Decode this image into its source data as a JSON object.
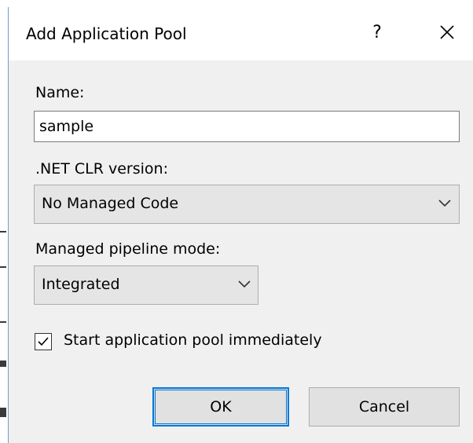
{
  "dialog": {
    "title": "Add Application Pool",
    "help_glyph": "?",
    "name_label": "Name:",
    "name_value": "sample",
    "clr_label": ".NET CLR version:",
    "clr_value": "No Managed Code",
    "pipeline_label": "Managed pipeline mode:",
    "pipeline_value": "Integrated",
    "start_label": "Start application pool immediately",
    "start_checked": true,
    "ok_label": "OK",
    "cancel_label": "Cancel"
  },
  "colors": {
    "accent": "#0078d7",
    "dialog_bg": "#f0f0f0",
    "titlebar_bg": "#ffffff"
  },
  "icons": {
    "close": "close-icon",
    "dropdown": "chevron-down-icon",
    "check": "check-icon"
  }
}
